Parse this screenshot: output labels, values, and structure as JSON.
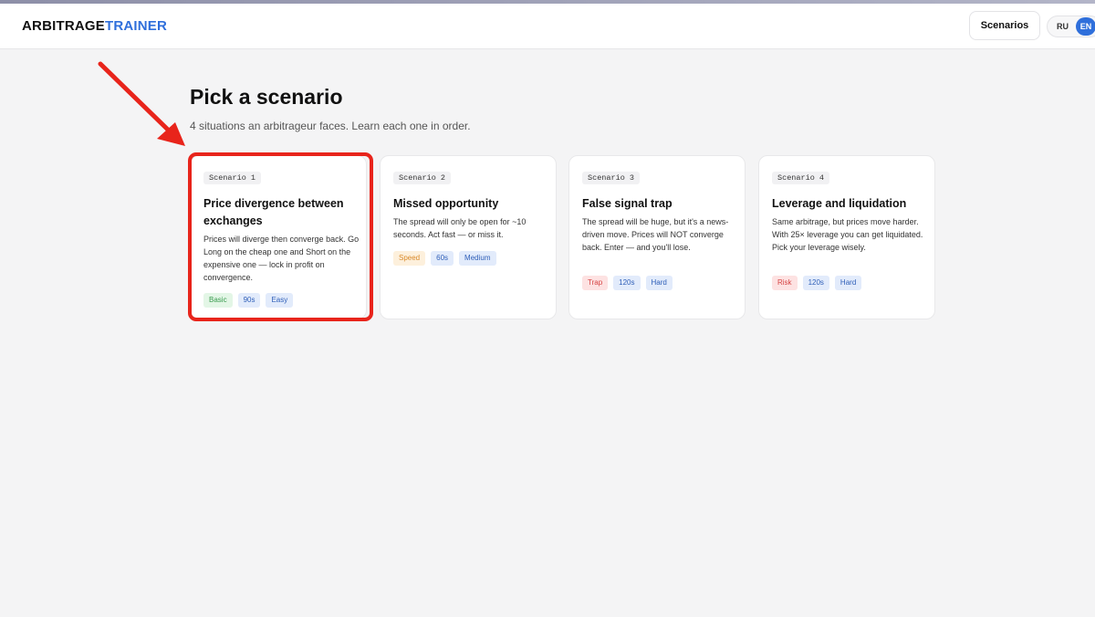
{
  "header": {
    "logo_part1": "ARBITRAGE",
    "logo_part2": "TRAINER",
    "nav_button": "Scenarios",
    "lang_ru": "RU",
    "lang_en": "EN"
  },
  "page": {
    "title": "Pick a scenario",
    "subtitle": "4 situations an arbitrageur faces. Learn each one in order."
  },
  "scenarios": [
    {
      "chip": "Scenario 1",
      "title": "Price divergence between exchanges",
      "description": "Prices will diverge then converge back. Go Long on the cheap one and Short on the expensive one — lock in profit on convergence.",
      "tags": [
        "Basic",
        "90s",
        "Easy"
      ]
    },
    {
      "chip": "Scenario 2",
      "title": "Missed opportunity",
      "description": "The spread will only be open for ~10 seconds. Act fast — or miss it.",
      "tags": [
        "Speed",
        "60s",
        "Medium"
      ]
    },
    {
      "chip": "Scenario 3",
      "title": "False signal trap",
      "description": "The spread will be huge, but it's a news-driven move. Prices will NOT converge back. Enter — and you'll lose.",
      "tags": [
        "Trap",
        "120s",
        "Hard"
      ]
    },
    {
      "chip": "Scenario 4",
      "title": "Leverage and liquidation",
      "description": "Same arbitrage, but prices move harder. With 25× leverage you can get liquidated. Pick your leverage wisely.",
      "tags": [
        "Risk",
        "120s",
        "Hard"
      ]
    }
  ],
  "colors": {
    "accent": "#2f6fdb",
    "highlight": "#e8241b",
    "tag_basic": "#e3f6e6",
    "tag_speed": "#fdf0dc",
    "tag_trap": "#fde2e2",
    "tag_blue": "#e2ebfb"
  }
}
